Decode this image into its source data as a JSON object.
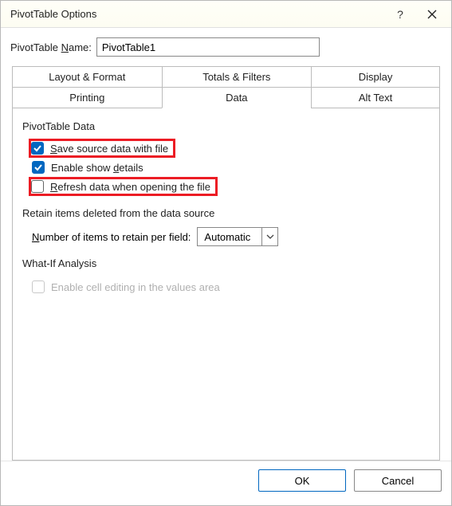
{
  "titlebar": {
    "title": "PivotTable Options",
    "help_label": "?",
    "close_label": "✕"
  },
  "name_row": {
    "label_pre": "PivotTable ",
    "label_u": "N",
    "label_post": "ame:",
    "value": "PivotTable1"
  },
  "tabs": {
    "row1": [
      "Layout & Format",
      "Totals & Filters",
      "Display"
    ],
    "row2": [
      "Printing",
      "Data",
      "Alt Text"
    ],
    "active": "Data"
  },
  "panel": {
    "section1": {
      "title": "PivotTable Data",
      "save_u": "S",
      "save_rest": "ave source data with file",
      "save_checked": true,
      "show_pre": "Enable show ",
      "show_u": "d",
      "show_post": "etails",
      "show_checked": true,
      "refresh_u": "R",
      "refresh_rest": "efresh data when opening the file",
      "refresh_checked": false
    },
    "section2": {
      "title": "Retain items deleted from the data source",
      "label_u": "N",
      "label_rest": "umber of items to retain per field:",
      "value": "Automatic"
    },
    "section3": {
      "title": "What-If Analysis",
      "cell_label": "Enable cell editing in the values area",
      "cell_checked": false,
      "cell_disabled": true
    }
  },
  "buttons": {
    "ok": "OK",
    "cancel": "Cancel"
  }
}
